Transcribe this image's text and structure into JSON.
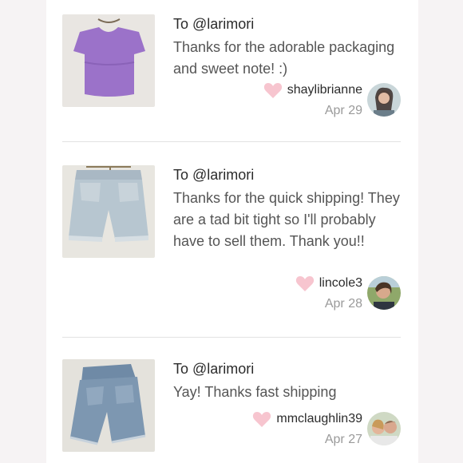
{
  "reviews": [
    {
      "to": "To @larimori",
      "message": "Thanks for the adorable packaging and sweet note! :)",
      "username": "shaylibrianne",
      "date": "Apr 29"
    },
    {
      "to": "To @larimori",
      "message": "Thanks for the quick shipping! They are a tad bit tight so I'll probably have to sell them. Thank you!!",
      "username": "lincole3",
      "date": "Apr 28"
    },
    {
      "to": "To @larimori",
      "message": "Yay! Thanks fast shipping",
      "username": "mmclaughlin39",
      "date": "Apr 27"
    }
  ],
  "icons": {
    "heart": "heart-icon",
    "heart_color": "#f7c5cf"
  }
}
